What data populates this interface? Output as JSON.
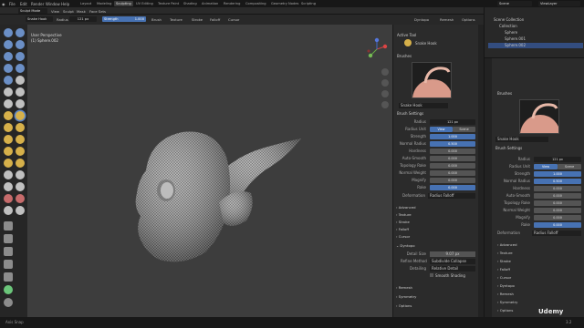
{
  "window": {
    "title": "Blender* [K:\\Work_n_Freelance\\3D_SKILLADEMY\\Blender\\04_CharacterRough\\old.blend]"
  },
  "topmenu": [
    "File",
    "Edit",
    "Render",
    "Window",
    "Help"
  ],
  "workspaces": [
    "Layout",
    "Modeling",
    "Sculpting",
    "UV Editing",
    "Texture Paint",
    "Shading",
    "Animation",
    "Rendering",
    "Compositing",
    "Geometry Nodes",
    "Scripting"
  ],
  "scene_field": "Scene",
  "viewlayer_field": "ViewLayer",
  "header2": {
    "mode": "Sculpt Mode",
    "items": [
      "View",
      "Sculpt",
      "Mask",
      "Face Sets"
    ]
  },
  "header3": {
    "tool_name": "Snake Hook",
    "radius_label": "Radius",
    "radius_value": "121 px",
    "strength_label": "Strength",
    "strength_value": "1.000",
    "menus": [
      "Brush",
      "Texture",
      "Stroke",
      "Falloff",
      "Cursor"
    ],
    "right_menus": [
      "Dyntopo",
      "Remesh",
      "Options"
    ]
  },
  "viewport": {
    "perspective": "User Perspective",
    "object": "(1) Sphere.002"
  },
  "npanel": {
    "active_tool_label": "Active Tool",
    "tool_name": "Snake Hook",
    "brushes_label": "Brushes",
    "brush_name": "Snake Hook",
    "brush_settings_label": "Brush Settings",
    "rows": [
      {
        "label": "Radius",
        "value": "121 px",
        "style": "dark"
      },
      {
        "label": "Radius Unit",
        "value": "View",
        "value2": "Scene",
        "style": "toggle"
      },
      {
        "label": "Strength",
        "value": "1.000",
        "style": "blue"
      },
      {
        "label": "Normal Radius",
        "value": "0.500",
        "style": "blue"
      },
      {
        "label": "Hardness",
        "value": "0.000",
        "style": "normal"
      },
      {
        "label": "Auto-Smooth",
        "value": "0.000",
        "style": "normal"
      },
      {
        "label": "Topology Rake",
        "value": "0.000",
        "style": "normal"
      },
      {
        "label": "Normal Weight",
        "value": "0.000",
        "style": "normal"
      },
      {
        "label": "Magnify",
        "value": "0.000",
        "style": "normal"
      },
      {
        "label": "Rake",
        "value": "0.000",
        "style": "blue"
      }
    ],
    "deformation_label": "Deformation",
    "deformation_value": "Radius Falloff",
    "sections": [
      "Advanced",
      "Texture",
      "Stroke",
      "Falloff",
      "Cursor"
    ],
    "dyntopo_label": "Dyntopo",
    "detail_size_label": "Detail Size",
    "detail_size_value": "9.07 px",
    "refine_label": "Refine Method",
    "refine_value": "Subdivide Collapse",
    "detailing_label": "Detailing",
    "detailing_value": "Relative Detail",
    "smooth_shading_label": "Smooth Shading",
    "bottom_sections": [
      "Remesh",
      "Symmetry",
      "Options"
    ]
  },
  "outliner": {
    "title": "Scene Collection",
    "items": [
      "Collection",
      "Sphere",
      "Sphere.001",
      "Sphere.002"
    ]
  },
  "props": {
    "brushes_label": "Brushes",
    "brush_name": "Snake Hook",
    "brush_settings_label": "Brush Settings",
    "rows": [
      {
        "label": "Radius",
        "value": "121 px",
        "style": "dark"
      },
      {
        "label": "Radius Unit",
        "value": "View",
        "value2": "Scene",
        "style": "toggle"
      },
      {
        "label": "Strength",
        "value": "1.000",
        "style": "blue"
      },
      {
        "label": "Normal Radius",
        "value": "0.500",
        "style": "blue"
      },
      {
        "label": "Hardness",
        "value": "0.000",
        "style": "normal"
      },
      {
        "label": "Auto-Smooth",
        "value": "0.000",
        "style": "normal"
      },
      {
        "label": "Topology Rake",
        "value": "0.000",
        "style": "normal"
      },
      {
        "label": "Normal Weight",
        "value": "0.000",
        "style": "normal"
      },
      {
        "label": "Magnify",
        "value": "0.000",
        "style": "normal"
      },
      {
        "label": "Rake",
        "value": "0.000",
        "style": "blue"
      }
    ],
    "deformation_label": "Deformation",
    "deformation_value": "Radius Falloff",
    "sections": [
      "Advanced",
      "Texture",
      "Stroke",
      "Falloff",
      "Cursor",
      "Dyntopo",
      "Remesh",
      "Symmetry",
      "Options"
    ]
  },
  "status": {
    "left": "Axis Snap",
    "version": "3.2"
  },
  "brand": "Udemy"
}
